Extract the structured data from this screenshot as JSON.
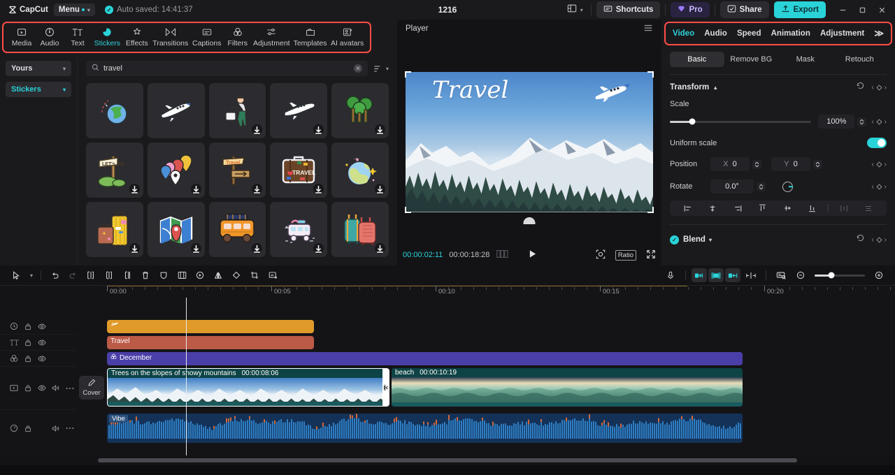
{
  "titlebar": {
    "app_name": "CapCut",
    "menu_label": "Menu",
    "autosave": "Auto saved: 14:41:37",
    "project_title": "1216",
    "layout_icon": "layout-icon",
    "shortcuts_label": "Shortcuts",
    "pro_label": "Pro",
    "share_label": "Share",
    "export_label": "Export",
    "minimize": "–",
    "maximize": "❐",
    "close": "✕"
  },
  "nav": {
    "highlight_color": "#ff4d45",
    "items": [
      {
        "label": "Media",
        "icon": "media-icon",
        "active": false
      },
      {
        "label": "Audio",
        "icon": "audio-icon",
        "active": false
      },
      {
        "label": "Text",
        "icon": "text-icon",
        "active": false
      },
      {
        "label": "Stickers",
        "icon": "stickers-icon",
        "active": true
      },
      {
        "label": "Effects",
        "icon": "effects-icon",
        "active": false
      },
      {
        "label": "Transitions",
        "icon": "transitions-icon",
        "active": false
      },
      {
        "label": "Captions",
        "icon": "captions-icon",
        "active": false
      },
      {
        "label": "Filters",
        "icon": "filters-icon",
        "active": false
      },
      {
        "label": "Adjustment",
        "icon": "adjustment-icon",
        "active": false
      },
      {
        "label": "Templates",
        "icon": "templates-icon",
        "active": false
      },
      {
        "label": "AI avatars",
        "icon": "ai-avatars-icon",
        "active": false
      }
    ]
  },
  "library": {
    "source_select": "Yours",
    "category_select": "Stickers",
    "search_value": "travel",
    "search_placeholder": "Search",
    "filter_icon": "sort-filter-icon",
    "stickers": [
      {
        "name": "globe-with-plane-sticker",
        "download": false
      },
      {
        "name": "airplane-sticker",
        "download": false
      },
      {
        "name": "traveler-with-luggage-sticker",
        "download": true
      },
      {
        "name": "jet-plane-sticker",
        "download": true
      },
      {
        "name": "trees-sticker",
        "download": true
      },
      {
        "name": "lets-go-signpost-sticker",
        "download": true
      },
      {
        "name": "map-pins-sticker",
        "download": true
      },
      {
        "name": "travel-signpost-sticker",
        "download": true
      },
      {
        "name": "travel-suitcase-sticker",
        "download": true
      },
      {
        "name": "earth-with-car-sticker",
        "download": true
      },
      {
        "name": "yellow-suitcases-sticker",
        "download": true
      },
      {
        "name": "folded-map-sticker",
        "download": true
      },
      {
        "name": "orange-van-sticker",
        "download": true
      },
      {
        "name": "camper-van-sticker",
        "download": true
      },
      {
        "name": "teal-red-luggage-sticker",
        "download": true
      }
    ]
  },
  "player": {
    "title": "Player",
    "menu_icon": "hamburger-icon",
    "overlay_text": "Travel",
    "current_time": "00:00:02:11",
    "total_time": "00:00:18:28",
    "frames_icon": "frames-icon",
    "play_icon": "play-icon",
    "zoom_fit_icon": "zoom-fit-icon",
    "ratio_label": "Ratio",
    "fullscreen_icon": "fullscreen-icon"
  },
  "inspector": {
    "highlight_color": "#ff4d45",
    "tabs": [
      {
        "label": "Video",
        "active": true
      },
      {
        "label": "Audio",
        "active": false
      },
      {
        "label": "Speed",
        "active": false
      },
      {
        "label": "Animation",
        "active": false
      },
      {
        "label": "Adjustment",
        "active": false
      }
    ],
    "more_label": "≫",
    "subtabs": [
      {
        "label": "Basic",
        "active": true
      },
      {
        "label": "Remove BG",
        "active": false
      },
      {
        "label": "Mask",
        "active": false
      },
      {
        "label": "Retouch",
        "active": false
      }
    ],
    "transform": {
      "title": "Transform",
      "collapse_icon": "chevron-up-icon",
      "reset_icon": "reset-icon",
      "keyframe_icon": "keyframe-icon",
      "scale_label": "Scale",
      "scale_value": "100%",
      "uniform_label": "Uniform scale",
      "uniform_on": true,
      "position_label": "Position",
      "position_x_axis": "X",
      "position_x": "0",
      "position_y_axis": "Y",
      "position_y": "0",
      "rotate_label": "Rotate",
      "rotate_value": "0.0°"
    },
    "align_icons": [
      "align-left-icon",
      "align-center-h-icon",
      "align-right-icon",
      "align-top-icon",
      "align-middle-v-icon",
      "align-bottom-icon",
      "distribute-h-icon",
      "distribute-v-icon"
    ],
    "blend": {
      "label": "Blend",
      "enabled": true,
      "chevron": "chevron-down-icon"
    }
  },
  "timeline": {
    "tools_left": [
      "select-tool",
      "undo",
      "redo",
      "split",
      "trim-left",
      "trim-right",
      "delete",
      "mask-shape",
      "freeze",
      "reverse",
      "mirror",
      "rotate",
      "crop",
      "remove-bg"
    ],
    "tools_right": [
      "record-voiceover",
      "auto-cut-left",
      "auto-cut-both",
      "auto-cut-right",
      "split-marker",
      "preview-render",
      "zoom-out",
      "zoom-in"
    ],
    "ruler_labels": [
      "00:00",
      "00:05",
      "00:10",
      "00:15",
      "00:20"
    ],
    "playhead_time": "00:00:02:11",
    "cover_label": "Cover",
    "tracks": [
      {
        "kind": "sticker",
        "head_icon": "sticker-track-icon",
        "controls": [
          "lock-icon",
          "eye-icon"
        ],
        "clips": [
          {
            "label": "",
            "icon": "plane-glyph",
            "start_pct": 0,
            "width_pct": 30.5
          }
        ]
      },
      {
        "kind": "text",
        "head_icon": "text-track-icon",
        "controls": [
          "lock-icon",
          "eye-icon"
        ],
        "clips": [
          {
            "label": "Travel",
            "start_pct": 0,
            "width_pct": 30.5
          }
        ]
      },
      {
        "kind": "effect",
        "head_icon": "effect-track-icon",
        "controls": [
          "lock-icon",
          "eye-icon"
        ],
        "clips": [
          {
            "label": "December",
            "icon": "effect-glyph",
            "start_pct": 0,
            "width_pct": 100
          }
        ]
      },
      {
        "kind": "video",
        "head_icon": "video-track-icon",
        "controls": [
          "lock-icon",
          "eye-icon",
          "volume-icon",
          "more-icon"
        ],
        "clips": [
          {
            "label": "Trees on the slopes of snowy mountains",
            "duration": "00:00:08:06",
            "selected": true
          },
          {
            "label": "beach",
            "duration": "00:00:10:19",
            "selected": false
          }
        ]
      },
      {
        "kind": "audio",
        "head_icon": "audio-track-icon",
        "controls": [
          "lock-icon",
          "volume-icon",
          "more-icon"
        ],
        "clips": [
          {
            "label": "Vibe"
          }
        ]
      }
    ]
  }
}
